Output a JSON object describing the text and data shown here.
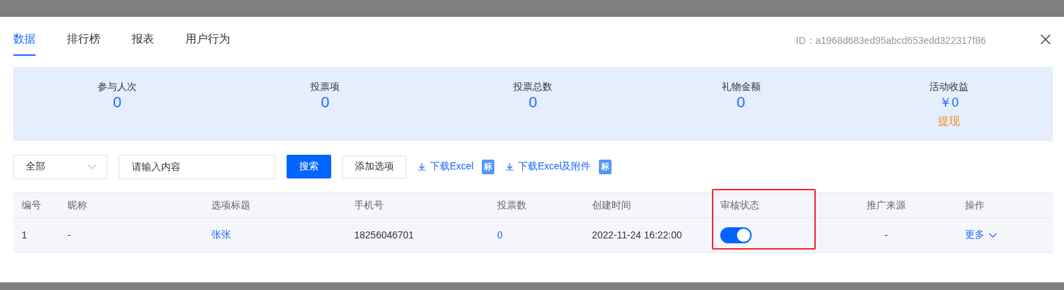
{
  "tabs": [
    {
      "label": "数据",
      "selected": true
    },
    {
      "label": "排行榜",
      "selected": false
    },
    {
      "label": "报表",
      "selected": false
    },
    {
      "label": "用户行为",
      "selected": false
    }
  ],
  "id_label": "ID：a1968d683ed95abcd653edd322317f86",
  "stats": [
    {
      "label": "参与人次",
      "value": "0"
    },
    {
      "label": "投票项",
      "value": "0"
    },
    {
      "label": "投票总数",
      "value": "0"
    },
    {
      "label": "礼物金额",
      "value": "0"
    },
    {
      "label": "活动收益",
      "value": "￥0",
      "action": "提现"
    }
  ],
  "filter": {
    "value": "全部"
  },
  "search": {
    "placeholder": "请输入内容"
  },
  "buttons": [
    {
      "label": "搜索",
      "primary": true
    },
    {
      "label": "添加选项",
      "primary": false
    }
  ],
  "downloads": [
    {
      "label": "下载Excel",
      "badge": "标"
    },
    {
      "label": "下载Excel及附件",
      "badge": "标"
    }
  ],
  "table": {
    "columns": [
      {
        "label": "编号",
        "highlighted": false
      },
      {
        "label": "昵称",
        "highlighted": false
      },
      {
        "label": "选项标题",
        "highlighted": false
      },
      {
        "label": "手机号",
        "highlighted": false
      },
      {
        "label": "投票数",
        "highlighted": false
      },
      {
        "label": "创建时间",
        "highlighted": false
      },
      {
        "label": "审核状态",
        "highlighted": true
      },
      {
        "label": "推广来源",
        "highlighted": false
      },
      {
        "label": "操作",
        "highlighted": false
      }
    ],
    "rows": [
      {
        "cells": [
          {
            "kind": "text",
            "text": "1"
          },
          {
            "kind": "text",
            "text": "-"
          },
          {
            "kind": "link",
            "text": "张张"
          },
          {
            "kind": "text",
            "text": "18256046701"
          },
          {
            "kind": "link",
            "text": "0"
          },
          {
            "kind": "text",
            "text": "2022-11-24 16:22:00"
          },
          {
            "kind": "toggle",
            "on": true
          },
          {
            "kind": "text",
            "text": "-"
          },
          {
            "kind": "menu",
            "text": "更多"
          }
        ]
      }
    ]
  }
}
